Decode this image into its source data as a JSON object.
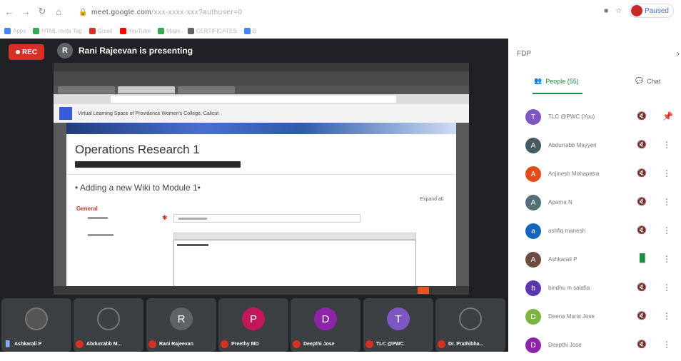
{
  "browser": {
    "url_host": "meet.google.com",
    "url_rest": "/xxx-xxxx-xxx?authuser=0",
    "profile_label": "Paused",
    "bookmarks": [
      {
        "label": "Apps",
        "color": "#4285f4"
      },
      {
        "label": "HTML meta Tag",
        "color": "#34a853"
      },
      {
        "label": "Gmail",
        "color": "#d93025"
      },
      {
        "label": "YouTube",
        "color": "#ff0000"
      },
      {
        "label": "Maps",
        "color": "#34a853"
      },
      {
        "label": "CERTIFICATES",
        "color": "#5f6368"
      },
      {
        "label": "D",
        "color": "#4285f4"
      }
    ]
  },
  "meet": {
    "rec_label": "REC",
    "presenter_initial": "R",
    "presenting_text": "Rani Rajeevan is presenting",
    "shared_screen": {
      "site_header": "Virtual Learning Space of Providence Women's College, Calicut",
      "course_title": "Operations Research 1",
      "section_heading": "• Adding a new Wiki to Module 1•",
      "expand_all": "Expand all",
      "general_label": "General"
    },
    "tiles": [
      {
        "name": "Ashkarali P",
        "initial": "",
        "color": "#555555",
        "muted": false,
        "photo": true
      },
      {
        "name": "Abdurrabb M...",
        "initial": "",
        "color": "#3c4043",
        "muted": true,
        "photo": true
      },
      {
        "name": "Rani Rajeevan",
        "initial": "R",
        "color": "#5f6368",
        "muted": true,
        "photo": false
      },
      {
        "name": "Preethy MD",
        "initial": "P",
        "color": "#c2185b",
        "muted": true,
        "photo": false
      },
      {
        "name": "Deepthi Jose",
        "initial": "D",
        "color": "#8e24aa",
        "muted": true,
        "photo": false
      },
      {
        "name": "TLC @PWC",
        "initial": "T",
        "color": "#7e57c2",
        "muted": true,
        "photo": false
      },
      {
        "name": "Dr. Prathibha...",
        "initial": "",
        "color": "#3c4043",
        "muted": true,
        "photo": true
      }
    ]
  },
  "sidebar": {
    "title": "FDP",
    "people_tab": "People (55)",
    "chat_tab": "Chat",
    "people": [
      {
        "name": "TLC @PWC (You)",
        "initial": "T",
        "color": "#7e57c2",
        "speaking": false,
        "action": "pin"
      },
      {
        "name": "Abdurrabb Mayyeri",
        "initial": "A",
        "color": "#455a64",
        "speaking": false,
        "action": "more"
      },
      {
        "name": "Anjinesh Mohapatra",
        "initial": "A",
        "color": "#e64a19",
        "speaking": false,
        "action": "more"
      },
      {
        "name": "Aparna N",
        "initial": "A",
        "color": "#546e7a",
        "speaking": false,
        "action": "more"
      },
      {
        "name": "ashfiq manesh",
        "initial": "a",
        "color": "#1565c0",
        "speaking": false,
        "action": "more"
      },
      {
        "name": "Ashkarali P",
        "initial": "A",
        "color": "#6d4c41",
        "speaking": true,
        "action": "more"
      },
      {
        "name": "bindhu m salafia",
        "initial": "b",
        "color": "#5e35b1",
        "speaking": false,
        "action": "more"
      },
      {
        "name": "Deena Maria Jose",
        "initial": "D",
        "color": "#7cb342",
        "speaking": false,
        "action": "more"
      },
      {
        "name": "Deepthi Jose",
        "initial": "D",
        "color": "#8e24aa",
        "speaking": false,
        "action": "more"
      }
    ]
  }
}
